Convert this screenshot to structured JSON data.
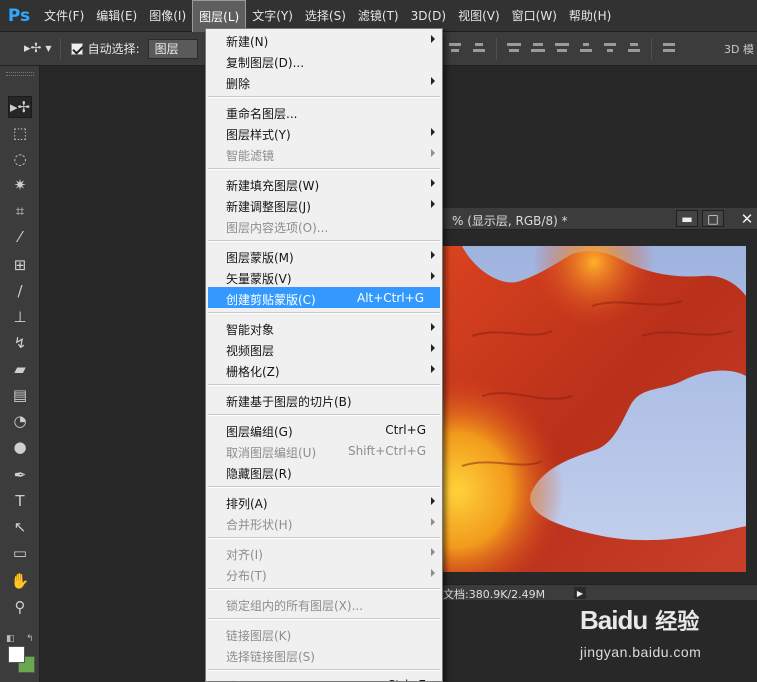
{
  "app": {
    "logo": "Ps"
  },
  "menubar": {
    "items": [
      {
        "label": "文件(F)"
      },
      {
        "label": "编辑(E)"
      },
      {
        "label": "图像(I)"
      },
      {
        "label": "图层(L)",
        "active": true
      },
      {
        "label": "文字(Y)"
      },
      {
        "label": "选择(S)"
      },
      {
        "label": "滤镜(T)"
      },
      {
        "label": "3D(D)"
      },
      {
        "label": "视图(V)"
      },
      {
        "label": "窗口(W)"
      },
      {
        "label": "帮助(H)"
      }
    ]
  },
  "options_bar": {
    "auto_select_label": "自动选择:",
    "auto_select_checked": true,
    "auto_select_target": "图层",
    "mode_3d_label": "3D 模"
  },
  "tools": [
    {
      "icon": "move-tool-icon",
      "glyph": "▸✢",
      "selected": true
    },
    {
      "icon": "marquee-tool-icon",
      "glyph": "⬚"
    },
    {
      "icon": "lasso-tool-icon",
      "glyph": "◌"
    },
    {
      "icon": "magic-wand-tool-icon",
      "glyph": "✷"
    },
    {
      "icon": "crop-tool-icon",
      "glyph": "⌗"
    },
    {
      "icon": "eyedropper-tool-icon",
      "glyph": "⁄"
    },
    {
      "icon": "healing-brush-tool-icon",
      "glyph": "⊞"
    },
    {
      "icon": "brush-tool-icon",
      "glyph": "∕"
    },
    {
      "icon": "clone-stamp-tool-icon",
      "glyph": "⊥"
    },
    {
      "icon": "history-brush-tool-icon",
      "glyph": "↯"
    },
    {
      "icon": "eraser-tool-icon",
      "glyph": "▰"
    },
    {
      "icon": "gradient-tool-icon",
      "glyph": "▤"
    },
    {
      "icon": "blur-tool-icon",
      "glyph": "◔"
    },
    {
      "icon": "dodge-tool-icon",
      "glyph": "●"
    },
    {
      "icon": "pen-tool-icon",
      "glyph": "✒"
    },
    {
      "icon": "type-tool-icon",
      "glyph": "T"
    },
    {
      "icon": "path-selection-tool-icon",
      "glyph": "↖"
    },
    {
      "icon": "shape-tool-icon",
      "glyph": "▭"
    },
    {
      "icon": "hand-tool-icon",
      "glyph": "✋"
    },
    {
      "icon": "zoom-tool-icon",
      "glyph": "⚲"
    }
  ],
  "colors": {
    "foreground": "#ffffff",
    "background": "#6aa84f",
    "highlight": "#3399ff",
    "ps_blue": "#31a8ff"
  },
  "document": {
    "title": "% (显示层, RGB/8) *",
    "status": "文档:380.9K/2.49M",
    "minimize_glyph": "▬",
    "maximize_glyph": "□",
    "close_glyph": "✕"
  },
  "layer_menu": {
    "items": [
      {
        "type": "item",
        "label": "新建(N)",
        "submenu": true
      },
      {
        "type": "item",
        "label": "复制图层(D)..."
      },
      {
        "type": "item",
        "label": "删除",
        "submenu": true
      },
      {
        "type": "sep"
      },
      {
        "type": "item",
        "label": "重命名图层..."
      },
      {
        "type": "item",
        "label": "图层样式(Y)",
        "submenu": true
      },
      {
        "type": "item",
        "label": "智能滤镜",
        "submenu": true,
        "disabled": true
      },
      {
        "type": "sep"
      },
      {
        "type": "item",
        "label": "新建填充图层(W)",
        "submenu": true
      },
      {
        "type": "item",
        "label": "新建调整图层(J)",
        "submenu": true
      },
      {
        "type": "item",
        "label": "图层内容选项(O)...",
        "disabled": true
      },
      {
        "type": "sep"
      },
      {
        "type": "item",
        "label": "图层蒙版(M)",
        "submenu": true
      },
      {
        "type": "item",
        "label": "矢量蒙版(V)",
        "submenu": true
      },
      {
        "type": "item",
        "label": "创建剪贴蒙版(C)",
        "shortcut": "Alt+Ctrl+G",
        "highlighted": true
      },
      {
        "type": "sep"
      },
      {
        "type": "item",
        "label": "智能对象",
        "submenu": true
      },
      {
        "type": "item",
        "label": "视频图层",
        "submenu": true
      },
      {
        "type": "item",
        "label": "栅格化(Z)",
        "submenu": true
      },
      {
        "type": "sep"
      },
      {
        "type": "item",
        "label": "新建基于图层的切片(B)"
      },
      {
        "type": "sep"
      },
      {
        "type": "item",
        "label": "图层编组(G)",
        "shortcut": "Ctrl+G"
      },
      {
        "type": "item",
        "label": "取消图层编组(U)",
        "shortcut": "Shift+Ctrl+G",
        "disabled": true
      },
      {
        "type": "item",
        "label": "隐藏图层(R)"
      },
      {
        "type": "sep"
      },
      {
        "type": "item",
        "label": "排列(A)",
        "submenu": true
      },
      {
        "type": "item",
        "label": "合并形状(H)",
        "submenu": true,
        "disabled": true
      },
      {
        "type": "sep"
      },
      {
        "type": "item",
        "label": "对齐(I)",
        "submenu": true,
        "disabled": true
      },
      {
        "type": "item",
        "label": "分布(T)",
        "submenu": true,
        "disabled": true
      },
      {
        "type": "sep"
      },
      {
        "type": "item",
        "label": "锁定组内的所有图层(X)...",
        "disabled": true
      },
      {
        "type": "sep"
      },
      {
        "type": "item",
        "label": "链接图层(K)",
        "disabled": true
      },
      {
        "type": "item",
        "label": "选择链接图层(S)",
        "disabled": true
      },
      {
        "type": "sep"
      },
      {
        "type": "item",
        "label": "合并图层(E)",
        "shortcut": "Ctrl+E"
      }
    ]
  },
  "watermark": {
    "brand": "Baidu",
    "product": "经验",
    "url": "jingyan.baidu.com"
  }
}
